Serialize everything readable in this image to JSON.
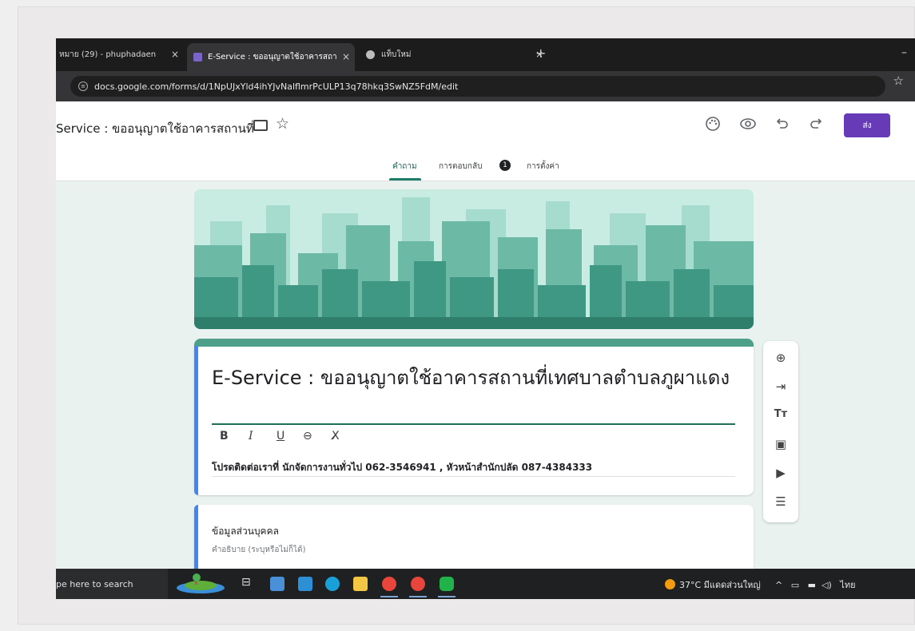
{
  "browser": {
    "tabs": [
      {
        "label": "หมาย (29) - phuphadaen"
      },
      {
        "label": "E-Service : ขออนุญาตใช้อาคารสถา"
      },
      {
        "label": "แท็บใหม่"
      }
    ],
    "url": "docs.google.com/forms/d/1NpUJxYld4ihYJvNalflmrPcULP13q78hkq3SwNZ5FdM/edit"
  },
  "form_header": {
    "title": "Service : ขออนุญาตใช้อาคารสถานที่",
    "send_label": "ส่ง",
    "tabs": [
      {
        "label": "คำถาม"
      },
      {
        "label": "การตอบกลับ"
      },
      {
        "label": "การตั้งค่า"
      }
    ],
    "responses_count": "1"
  },
  "title_card": {
    "title": "E-Service : ขออนุญาตใช้อาคารสถานที่เทศบาลตำบลภูผาแดง",
    "format_buttons": [
      "B",
      "I",
      "U",
      "⊖",
      "X̸"
    ],
    "description": "โปรดติดต่อเราที่  นักจัดการงานทั่วไป 062-3546941 , หัวหน้าสำนักปลัด 087-4384333"
  },
  "section_card": {
    "title": "ข้อมูลส่วนบุคคล",
    "description": "คำอธิบาย (ระบุหรือไม่ก็ได้)"
  },
  "taskbar": {
    "search_placeholder": "pe here to search",
    "weather": "37°C  มีแดดส่วนใหญ่",
    "language": "ไทย"
  },
  "icons": {
    "palette": "palette-icon",
    "preview": "eye-icon",
    "undo": "undo-icon",
    "redo": "redo-icon"
  }
}
